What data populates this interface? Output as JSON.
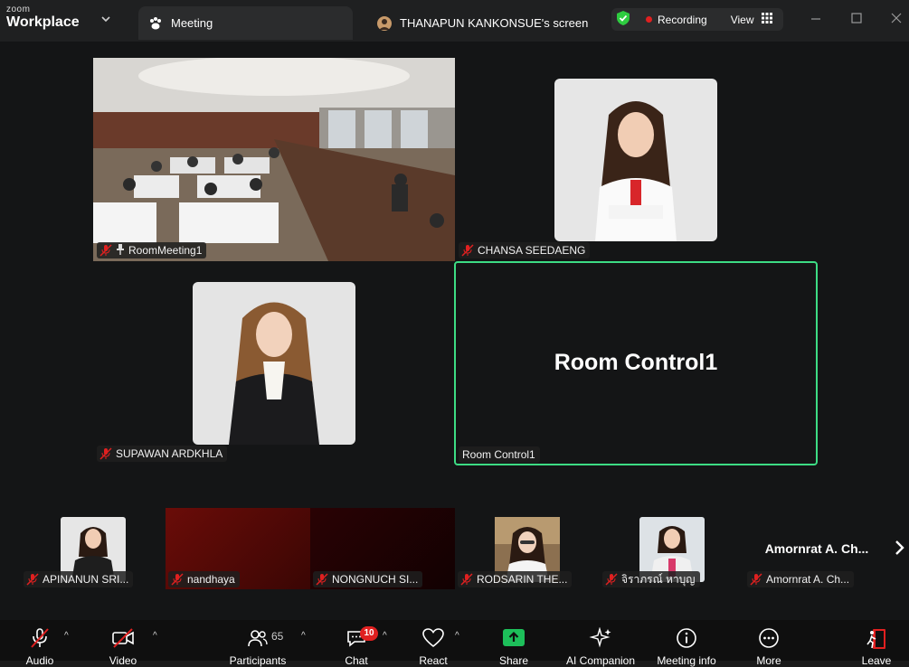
{
  "app": {
    "brand_small": "zoom",
    "brand_big": "Workplace"
  },
  "tabs": [
    {
      "label": "Meeting"
    },
    {
      "label": "THANAPUN KANKONSUE's screen"
    }
  ],
  "status": {
    "recording": "Recording",
    "view": "View"
  },
  "main_tiles": [
    {
      "name": "RoomMeeting1"
    },
    {
      "name": "CHANSA SEEDAENG"
    },
    {
      "name": "SUPAWAN ARDKHLA"
    },
    {
      "name": "Room Control1",
      "display": "Room Control1"
    }
  ],
  "strip": [
    {
      "name": "APINANUN SRI..."
    },
    {
      "name": "nandhaya"
    },
    {
      "name": "NONGNUCH SI..."
    },
    {
      "name": "RODSARIN THE..."
    },
    {
      "name": "จิราภรณ์ หาบุญ"
    },
    {
      "name": "Amornrat A. Ch...",
      "display": "Amornrat A. Ch..."
    }
  ],
  "toolbar": {
    "audio": "Audio",
    "video": "Video",
    "participants": "Participants",
    "participants_count": "65",
    "chat": "Chat",
    "chat_badge": "10",
    "react": "React",
    "share": "Share",
    "ai": "AI Companion",
    "info": "Meeting info",
    "more": "More",
    "leave": "Leave"
  }
}
